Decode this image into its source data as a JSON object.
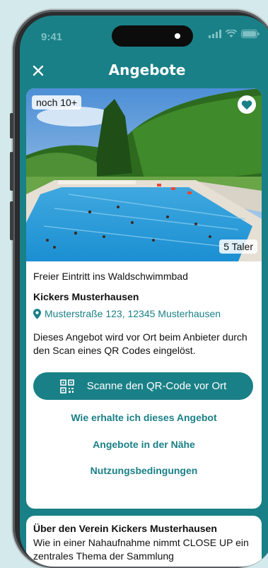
{
  "status_bar": {
    "time": "9:41"
  },
  "header": {
    "title": "Angebote",
    "close_icon": "close-icon"
  },
  "offer": {
    "remaining_badge": "noch 10+",
    "price_badge": "5 Taler",
    "title": "Freier Eintritt ins Waldschwimmbad",
    "organizer": "Kickers Musterhausen",
    "address": "Musterstraße 123, 12345 Musterhausen",
    "description": "Dieses Angebot wird vor Ort beim Anbieter durch den Scan eines QR Codes eingelöst.",
    "scan_button": "Scanne den QR-Code vor Ort",
    "links": {
      "how_to": "Wie erhalte ich dieses Angebot",
      "nearby": "Angebote in der Nähe",
      "terms": "Nutzungsbedingungen"
    }
  },
  "about": {
    "title": "Über den Verein Kickers Musterhausen",
    "text": "Wie in einer Nahaufnahme nimmt CLOSE UP ein zentrales Thema der Sammlung"
  },
  "colors": {
    "accent": "#1a8087",
    "background": "#d3e9ec"
  }
}
